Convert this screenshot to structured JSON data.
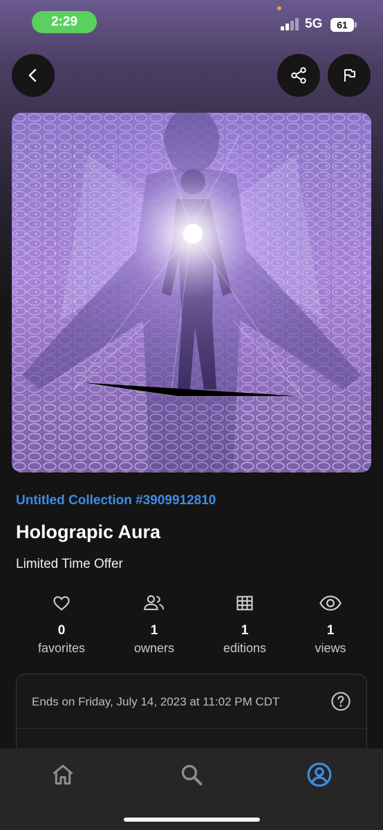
{
  "status_bar": {
    "time": "2:29",
    "network": "5G",
    "battery": "61"
  },
  "header": {
    "back_icon": "chevron-left-icon",
    "share_icon": "share-icon",
    "report_icon": "flag-icon"
  },
  "item": {
    "collection": "Untitled Collection #3909912810",
    "title": "Holograpic Aura",
    "description": "Limited Time Offer"
  },
  "stats": [
    {
      "icon": "heart-icon",
      "value": "0",
      "label": "favorites"
    },
    {
      "icon": "people-icon",
      "value": "1",
      "label": "owners"
    },
    {
      "icon": "grid-icon",
      "value": "1",
      "label": "editions"
    },
    {
      "icon": "eye-icon",
      "value": "1",
      "label": "views"
    }
  ],
  "sale": {
    "ends_text": "Ends on Friday, July 14, 2023 at 11:02 PM CDT"
  },
  "bottom_nav": [
    {
      "icon": "home-icon",
      "active": false
    },
    {
      "icon": "search-icon",
      "active": false
    },
    {
      "icon": "profile-icon",
      "active": true
    }
  ],
  "colors": {
    "accent": "#3f8de6",
    "status_time_bg": "#5ad15f",
    "background": "#141414"
  }
}
